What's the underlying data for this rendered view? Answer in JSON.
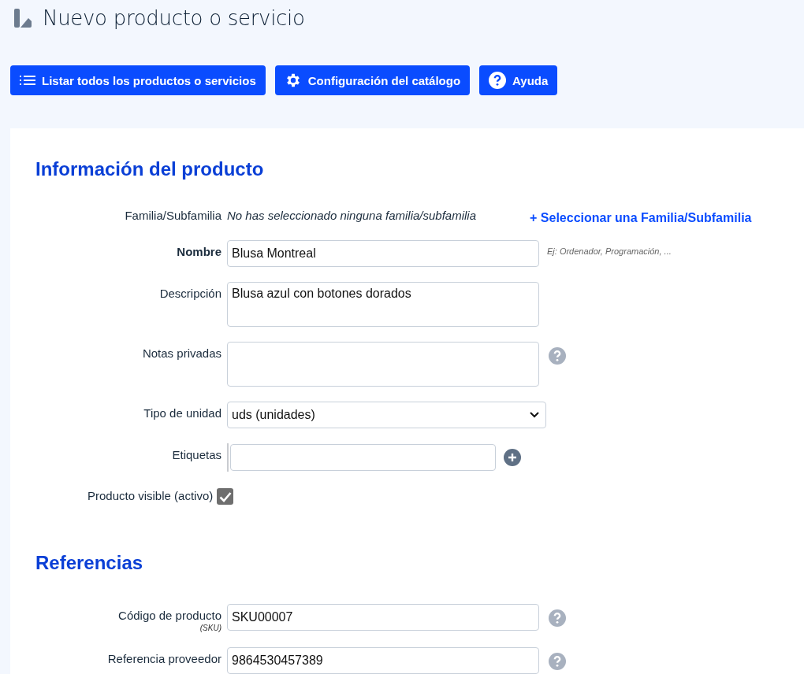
{
  "page": {
    "title": "Nuevo producto o servicio"
  },
  "toolbar": [
    {
      "kind": "list",
      "label": "Listar todos los productos o servicios"
    },
    {
      "kind": "settings",
      "label": "Configuración del catálogo"
    },
    {
      "kind": "help",
      "label": "Ayuda"
    }
  ],
  "sections": [
    {
      "title": "Información del producto",
      "rows": [
        {
          "kind": "info",
          "label": "Familia/Subfamilia",
          "value": "No has seleccionado ninguna familia/subfamilia",
          "link": "+ Seleccionar una Familia/Subfamilia"
        },
        {
          "kind": "input",
          "label": "Nombre",
          "required": true,
          "value": "Blusa Montreal",
          "hint": "Ej: Ordenador, Programación, ...",
          "help": false
        },
        {
          "kind": "textarea",
          "label": "Descripción",
          "required": false,
          "value": "Blusa azul con botones dorados",
          "help": false
        },
        {
          "kind": "textarea",
          "label": "Notas privadas",
          "required": false,
          "value": "",
          "help": true
        },
        {
          "kind": "select",
          "label": "Tipo de unidad",
          "value": "uds (unidades)"
        },
        {
          "kind": "tags",
          "label": "Etiquetas"
        },
        {
          "kind": "checkbox",
          "label": "Producto visible (activo)",
          "checked": true
        }
      ]
    },
    {
      "title": "Referencias",
      "rows": [
        {
          "kind": "input",
          "label": "Código de producto",
          "sublabel": "(SKU)",
          "required": false,
          "value": "SKU00007",
          "help": true
        },
        {
          "kind": "input",
          "label": "Referencia proveedor",
          "required": false,
          "value": "9864530457389",
          "help": true
        }
      ]
    }
  ]
}
